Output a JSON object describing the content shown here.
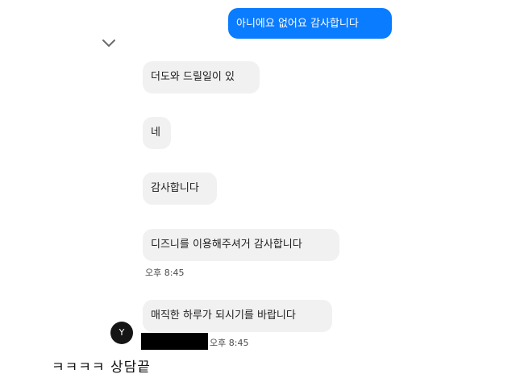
{
  "messages": {
    "outgoing": {
      "text": "아니에요 없어요 감사합니다"
    },
    "incoming": [
      {
        "text": "더도와 드릴일이 있"
      },
      {
        "text": "네"
      },
      {
        "text": "감사합니다"
      },
      {
        "text": "디즈니를 이용해주셔거 감사합니다",
        "time": "오후 8:45"
      },
      {
        "text": "매직한 하루가 되시기를 바랍니다",
        "time": "오후 8:45"
      }
    ]
  },
  "avatar": {
    "initial": "Y"
  },
  "caption": {
    "text": "ㅋㅋㅋㅋ 상담끝"
  },
  "icons": {
    "collapse": "chevron-down-icon"
  },
  "colors": {
    "outgoing_bubble": "#0a7cff",
    "incoming_bubble": "#f1f1f1",
    "avatar_bg": "#151515",
    "redaction": "#000000"
  }
}
